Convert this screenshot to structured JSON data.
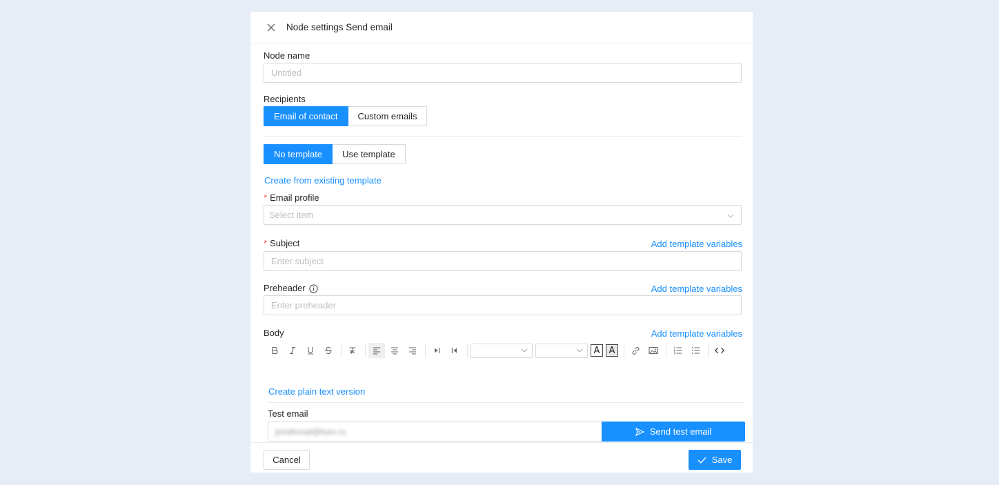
{
  "header": {
    "title": "Node settings Send email"
  },
  "node_name": {
    "label": "Node name",
    "placeholder": "Untitled"
  },
  "recipients": {
    "label": "Recipients",
    "options": [
      "Email of contact",
      "Custom emails"
    ],
    "selected": "Email of contact"
  },
  "template": {
    "options": [
      "No template",
      "Use template"
    ],
    "selected": "No template",
    "create_link": "Create from existing template"
  },
  "email_profile": {
    "required_mark": "*",
    "label": "Email profile",
    "placeholder": "Select item"
  },
  "subject": {
    "required_mark": "*",
    "label": "Subject",
    "placeholder": "Enter subject",
    "vars_link": "Add template variables"
  },
  "preheader": {
    "label": "Preheader",
    "placeholder": "Enter preheader",
    "vars_link": "Add template variables"
  },
  "body": {
    "label": "Body",
    "vars_link": "Add template variables",
    "plain_text_link": "Create plain text version"
  },
  "test_email": {
    "label": "Test email",
    "value": "jsmithmail@fusn.ru",
    "send_label": "Send test email"
  },
  "footer": {
    "cancel_label": "Cancel",
    "save_label": "Save"
  },
  "colors": {
    "accent": "#1890ff",
    "required": "#ff4d4f",
    "background": "#e6edf6"
  }
}
